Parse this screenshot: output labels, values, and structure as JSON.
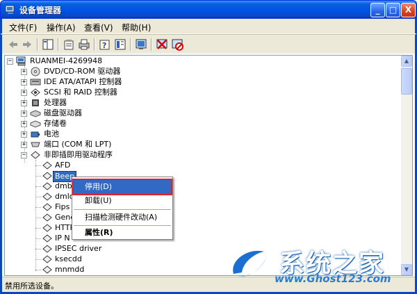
{
  "window": {
    "title": "设备管理器",
    "buttons": [
      "_",
      "□",
      "X"
    ]
  },
  "menubar": {
    "items": [
      "文件(F)",
      "操作(A)",
      "查看(V)",
      "帮助(H)"
    ]
  },
  "toolbar": {
    "buttons": [
      "back-icon",
      "forward-icon",
      "tree-view-icon",
      "properties-icon",
      "print-icon",
      "help-icon",
      "details-icon",
      "scan-icon",
      "uninstall-icon",
      "disable-icon"
    ]
  },
  "tree": {
    "root": "RUANMEI-4269948",
    "categories": [
      {
        "label": "DVD/CD-ROM 驱动器",
        "expander": "+"
      },
      {
        "label": "IDE ATA/ATAPI 控制器",
        "expander": "+"
      },
      {
        "label": "SCSI 和 RAID 控制器",
        "expander": "+"
      },
      {
        "label": "处理器",
        "expander": "+"
      },
      {
        "label": "磁盘驱动器",
        "expander": "+"
      },
      {
        "label": "存储卷",
        "expander": "+"
      },
      {
        "label": "电池",
        "expander": "+"
      },
      {
        "label": "端口 (COM 和 LPT)",
        "expander": "+"
      },
      {
        "label": "非即插即用驱动程序",
        "expander": "−"
      }
    ],
    "children": [
      "AFD",
      "Beep",
      "dmbo",
      "dmlo",
      "Fips",
      "Gene",
      "HTTP",
      "IP N",
      "IPSEC driver",
      "ksecdd",
      "mnmdd"
    ]
  },
  "context_menu": {
    "items": [
      {
        "label": "停用(D)",
        "highlight": true
      },
      {
        "label": "卸载(U)"
      },
      {
        "label": "扫描检测硬件改动(A)"
      },
      {
        "label": "属性(R)",
        "bold": true
      }
    ]
  },
  "statusbar": {
    "text": "禁用所选设备。"
  },
  "watermark": {
    "brand": "系统之家",
    "url": "www.Ghost123.com"
  }
}
